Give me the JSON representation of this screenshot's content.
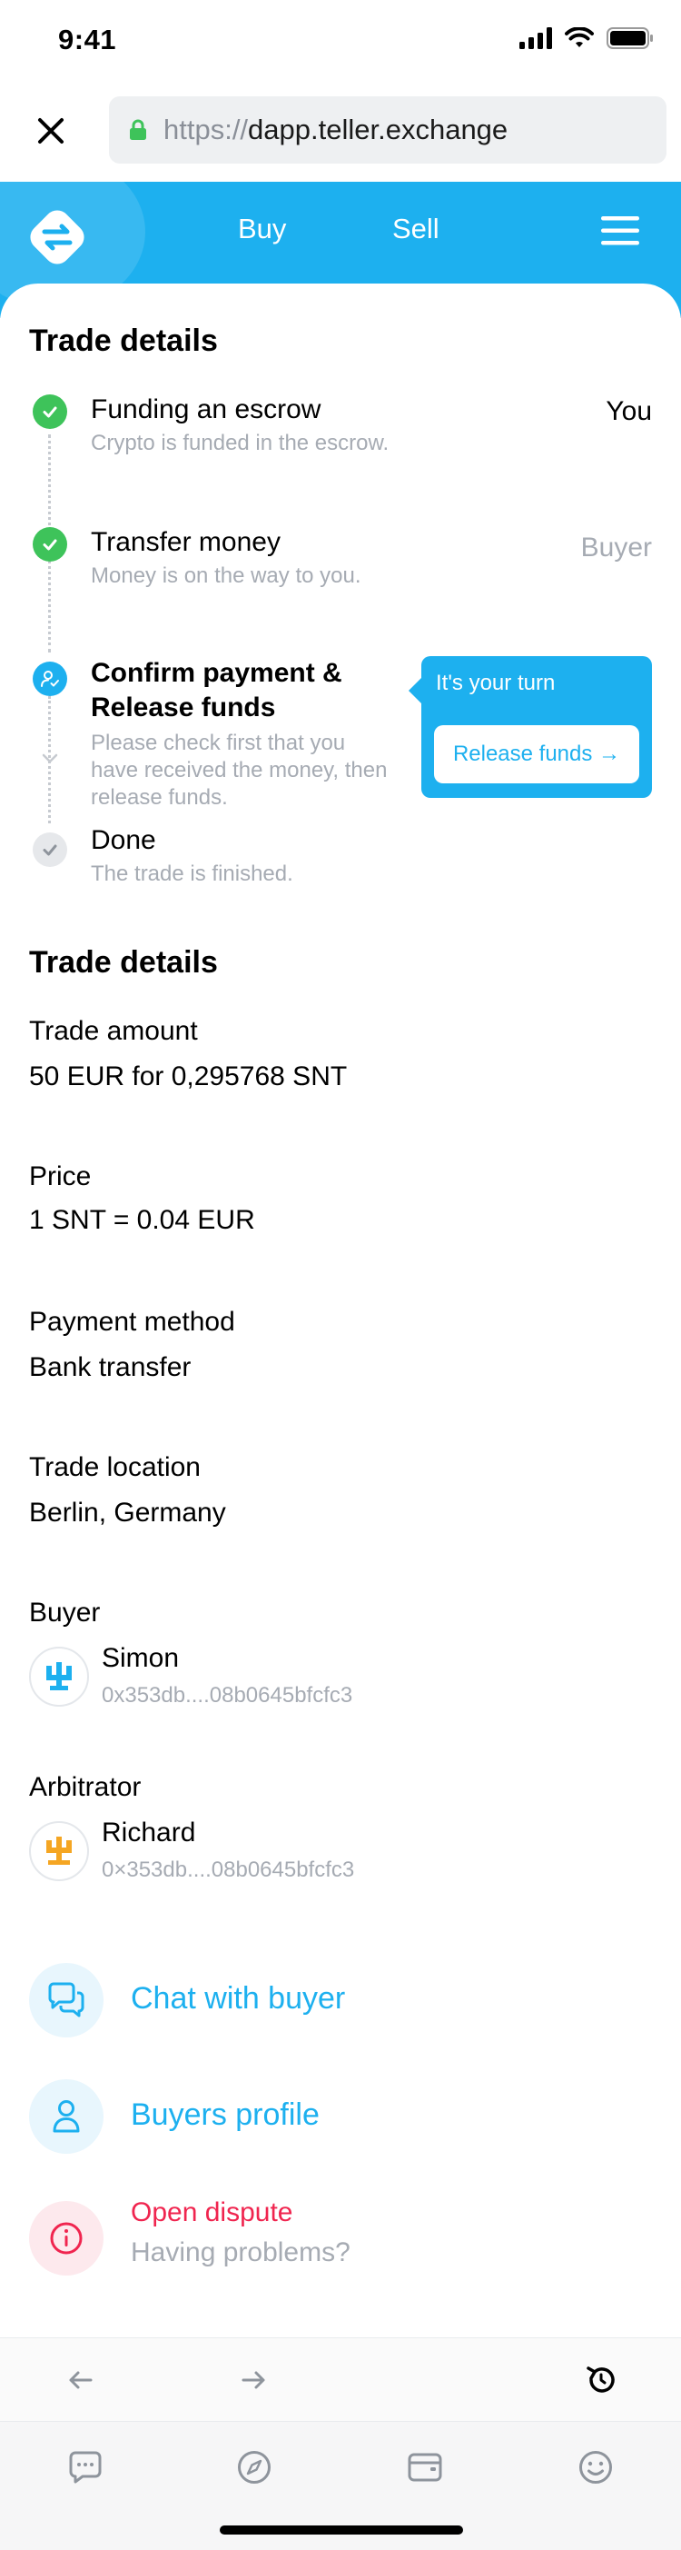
{
  "status_bar": {
    "time": "9:41"
  },
  "browser": {
    "url_scheme": "https://",
    "url_host": "dapp.teller.exchange"
  },
  "header": {
    "buy_label": "Buy",
    "sell_label": "Sell"
  },
  "trade_progress": {
    "title": "Trade details",
    "steps": [
      {
        "title": "Funding an escrow",
        "subtitle": "Crypto is funded in the escrow.",
        "party": "You",
        "state": "done"
      },
      {
        "title": "Transfer money",
        "subtitle": "Money is on the way to you.",
        "party": "Buyer",
        "state": "done"
      },
      {
        "title_line1": "Confirm payment &",
        "title_line2": "Release funds",
        "subtitle_line1": "Please check first that you",
        "subtitle_line2": "have received the money, then",
        "subtitle_line3": "release funds.",
        "state": "current"
      },
      {
        "title": "Done",
        "subtitle": "The trade is finished.",
        "state": "pending"
      }
    ],
    "turn_card": {
      "label": "It's your turn",
      "button_label": "Release funds →"
    }
  },
  "trade_details": {
    "title": "Trade details",
    "trade_amount_label": "Trade amount",
    "trade_amount_value": "50 EUR for 0,295768 SNT",
    "price_label": "Price",
    "price_value": "1 SNT = 0.04 EUR",
    "payment_method_label": "Payment method",
    "payment_method_value": "Bank transfer",
    "trade_location_label": "Trade location",
    "trade_location_value": "Berlin, Germany",
    "buyer_label": "Buyer",
    "buyer_name": "Simon",
    "buyer_address": "0x353db....08b0645bfcfc3",
    "arbitrator_label": "Arbitrator",
    "arbitrator_name": "Richard",
    "arbitrator_address": "0×353db....08b0645bfcfc3"
  },
  "actions": {
    "chat_label": "Chat with buyer",
    "profile_label": "Buyers profile",
    "dispute_label": "Open dispute",
    "dispute_sub": "Having problems?"
  },
  "colors": {
    "accent": "#1db0ef",
    "success": "#3ec35a",
    "danger": "#f0254f",
    "muted_text": "#a6abb3",
    "arbitrator_avatar": "#f5a623"
  },
  "icons": {
    "status": [
      "cellular-signal-icon",
      "wifi-icon",
      "battery-icon"
    ],
    "browser": [
      "close-icon",
      "lock-icon"
    ],
    "header": [
      "teller-logo",
      "hamburger-menu-icon"
    ],
    "nav_toolbar": [
      "back-arrow-icon",
      "forward-arrow-icon",
      "reload-icon"
    ],
    "tab_bar": [
      "chat-icon",
      "compass-icon",
      "wallet-icon",
      "smiley-icon"
    ]
  }
}
